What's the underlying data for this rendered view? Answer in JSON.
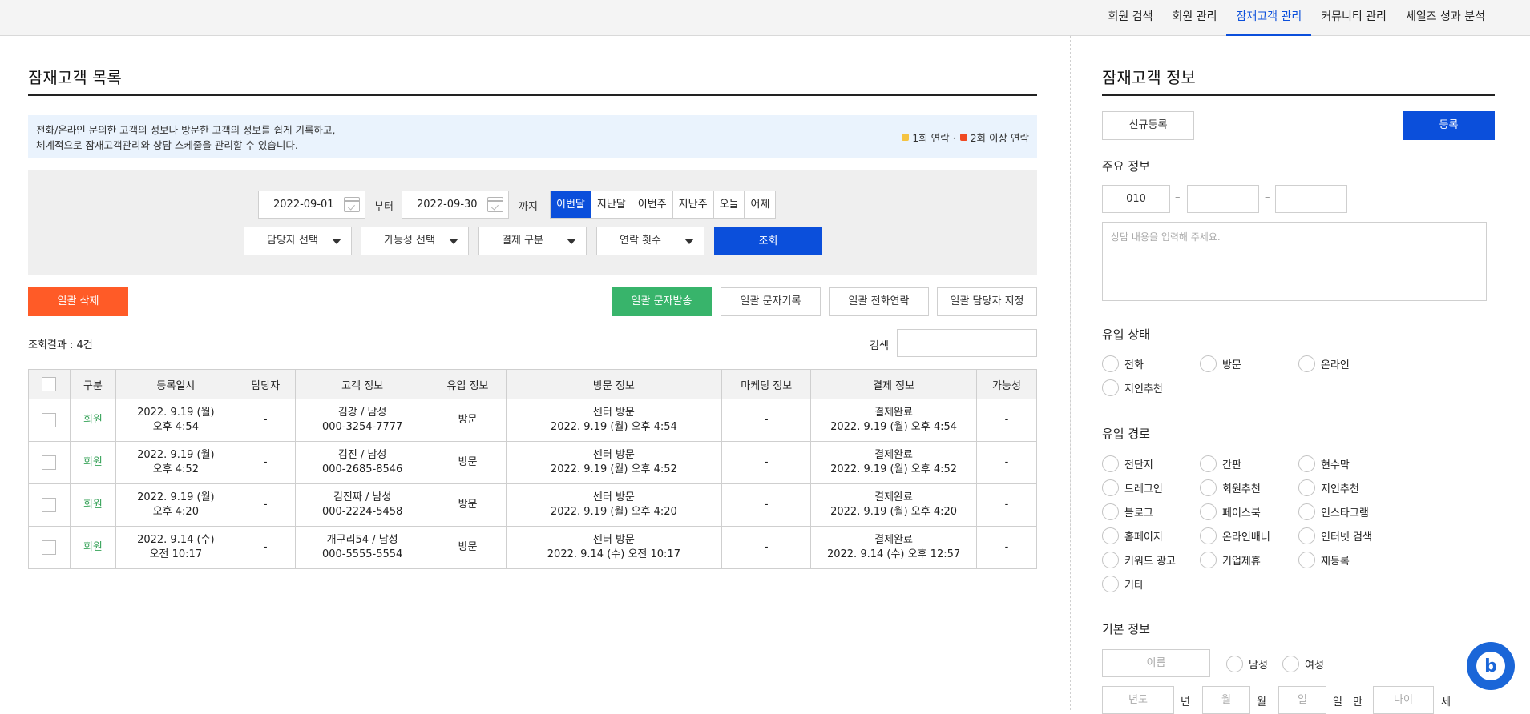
{
  "nav": {
    "items": [
      "회원 검색",
      "회원 관리",
      "잠재고객 관리",
      "커뮤니티 관리",
      "세일즈 성과 분석"
    ],
    "active": 2
  },
  "list": {
    "title": "잠재고객 목록",
    "info_line1": "전화/온라인 문의한 고객의 정보나 방문한 고객의 정보를 쉽게 기록하고,",
    "info_line2": "체계적으로 잠재고객관리와 상담 스케줄을 관리할 수 있습니다.",
    "legend1": "1회 연락 ·",
    "legend2": "2회 이상 연락",
    "legend1_color": "#f5c342",
    "legend2_color": "#f04a23"
  },
  "filter": {
    "date_from": "2022-09-01",
    "from_label": "부터",
    "date_to": "2022-09-30",
    "to_label": "까지",
    "periods": [
      "이번달",
      "지난달",
      "이번주",
      "지난주",
      "오늘",
      "어제"
    ],
    "active_period": 0,
    "selects": [
      "담당자 선택",
      "가능성 선택",
      "결제 구분",
      "연락 횟수"
    ],
    "search_label": "조회"
  },
  "actions": {
    "bulk_delete": "일괄 삭제",
    "bulk_sms": "일괄 문자발송",
    "bulk_sms_record": "일괄 문자기록",
    "bulk_call": "일괄 전화연락",
    "bulk_assign": "일괄 담당자 지정"
  },
  "result": {
    "count_text": "조회결과 : 4건",
    "search_label": "검색"
  },
  "table": {
    "headers": [
      "구분",
      "등록일시",
      "담당자",
      "고객 정보",
      "유입 정보",
      "방문 정보",
      "마케팅 정보",
      "결제 정보",
      "가능성"
    ],
    "rows": [
      {
        "type": "회원",
        "date1": "2022. 9.19 (월)",
        "date2": "오후 4:54",
        "staff": "-",
        "cust1": "김강 / 남성",
        "cust2": "000-3254-7777",
        "inflow": "방문",
        "visit1": "센터 방문",
        "visit2": "2022. 9.19 (월) 오후 4:54",
        "marketing": "-",
        "pay1": "결제완료",
        "pay2": "2022. 9.19 (월) 오후 4:54",
        "possibility": "-"
      },
      {
        "type": "회원",
        "date1": "2022. 9.19 (월)",
        "date2": "오후 4:52",
        "staff": "-",
        "cust1": "김진 / 남성",
        "cust2": "000-2685-8546",
        "inflow": "방문",
        "visit1": "센터 방문",
        "visit2": "2022. 9.19 (월) 오후 4:52",
        "marketing": "-",
        "pay1": "결제완료",
        "pay2": "2022. 9.19 (월) 오후 4:52",
        "possibility": "-"
      },
      {
        "type": "회원",
        "date1": "2022. 9.19 (월)",
        "date2": "오후 4:20",
        "staff": "-",
        "cust1": "김진짜 / 남성",
        "cust2": "000-2224-5458",
        "inflow": "방문",
        "visit1": "센터 방문",
        "visit2": "2022. 9.19 (월) 오후 4:20",
        "marketing": "-",
        "pay1": "결제완료",
        "pay2": "2022. 9.19 (월) 오후 4:20",
        "possibility": "-"
      },
      {
        "type": "회원",
        "date1": "2022. 9.14 (수)",
        "date2": "오전 10:17",
        "staff": "-",
        "cust1": "개구리54 / 남성",
        "cust2": "000-5555-5554",
        "inflow": "방문",
        "visit1": "센터 방문",
        "visit2": "2022. 9.14 (수) 오전 10:17",
        "marketing": "-",
        "pay1": "결제완료",
        "pay2": "2022. 9.14 (수) 오후 12:57",
        "possibility": "-"
      }
    ]
  },
  "detail": {
    "title": "잠재고객 정보",
    "new_label": "신규등록",
    "register_label": "등록",
    "main_info": "주요 정보",
    "phone1": "010",
    "consult_placeholder": "상담 내용을 입력해 주세요.",
    "inflow_status": "유입 상태",
    "status_options": [
      "전화",
      "방문",
      "온라인",
      "지인추천"
    ],
    "inflow_route": "유입 경로",
    "route_options": [
      "전단지",
      "간판",
      "현수막",
      "드레그인",
      "회원추천",
      "지인추천",
      "블로그",
      "페이스북",
      "인스타그램",
      "홈페이지",
      "온라인배너",
      "인터넷 검색",
      "키워드 광고",
      "기업제휴",
      "재등록",
      "기타"
    ],
    "basic_info": "기본 정보",
    "name_placeholder": "이름",
    "male": "남성",
    "female": "여성",
    "year_placeholder": "년도",
    "year_unit": "년",
    "month_placeholder": "월",
    "month_unit": "월",
    "day_placeholder": "일",
    "day_unit": "일",
    "full_label": "만",
    "age_placeholder": "나이",
    "age_unit": "세"
  },
  "colors": {
    "accent": "#0b4fdb",
    "danger": "#ff5b27",
    "success": "#38b46b",
    "member": "#38a35a"
  }
}
